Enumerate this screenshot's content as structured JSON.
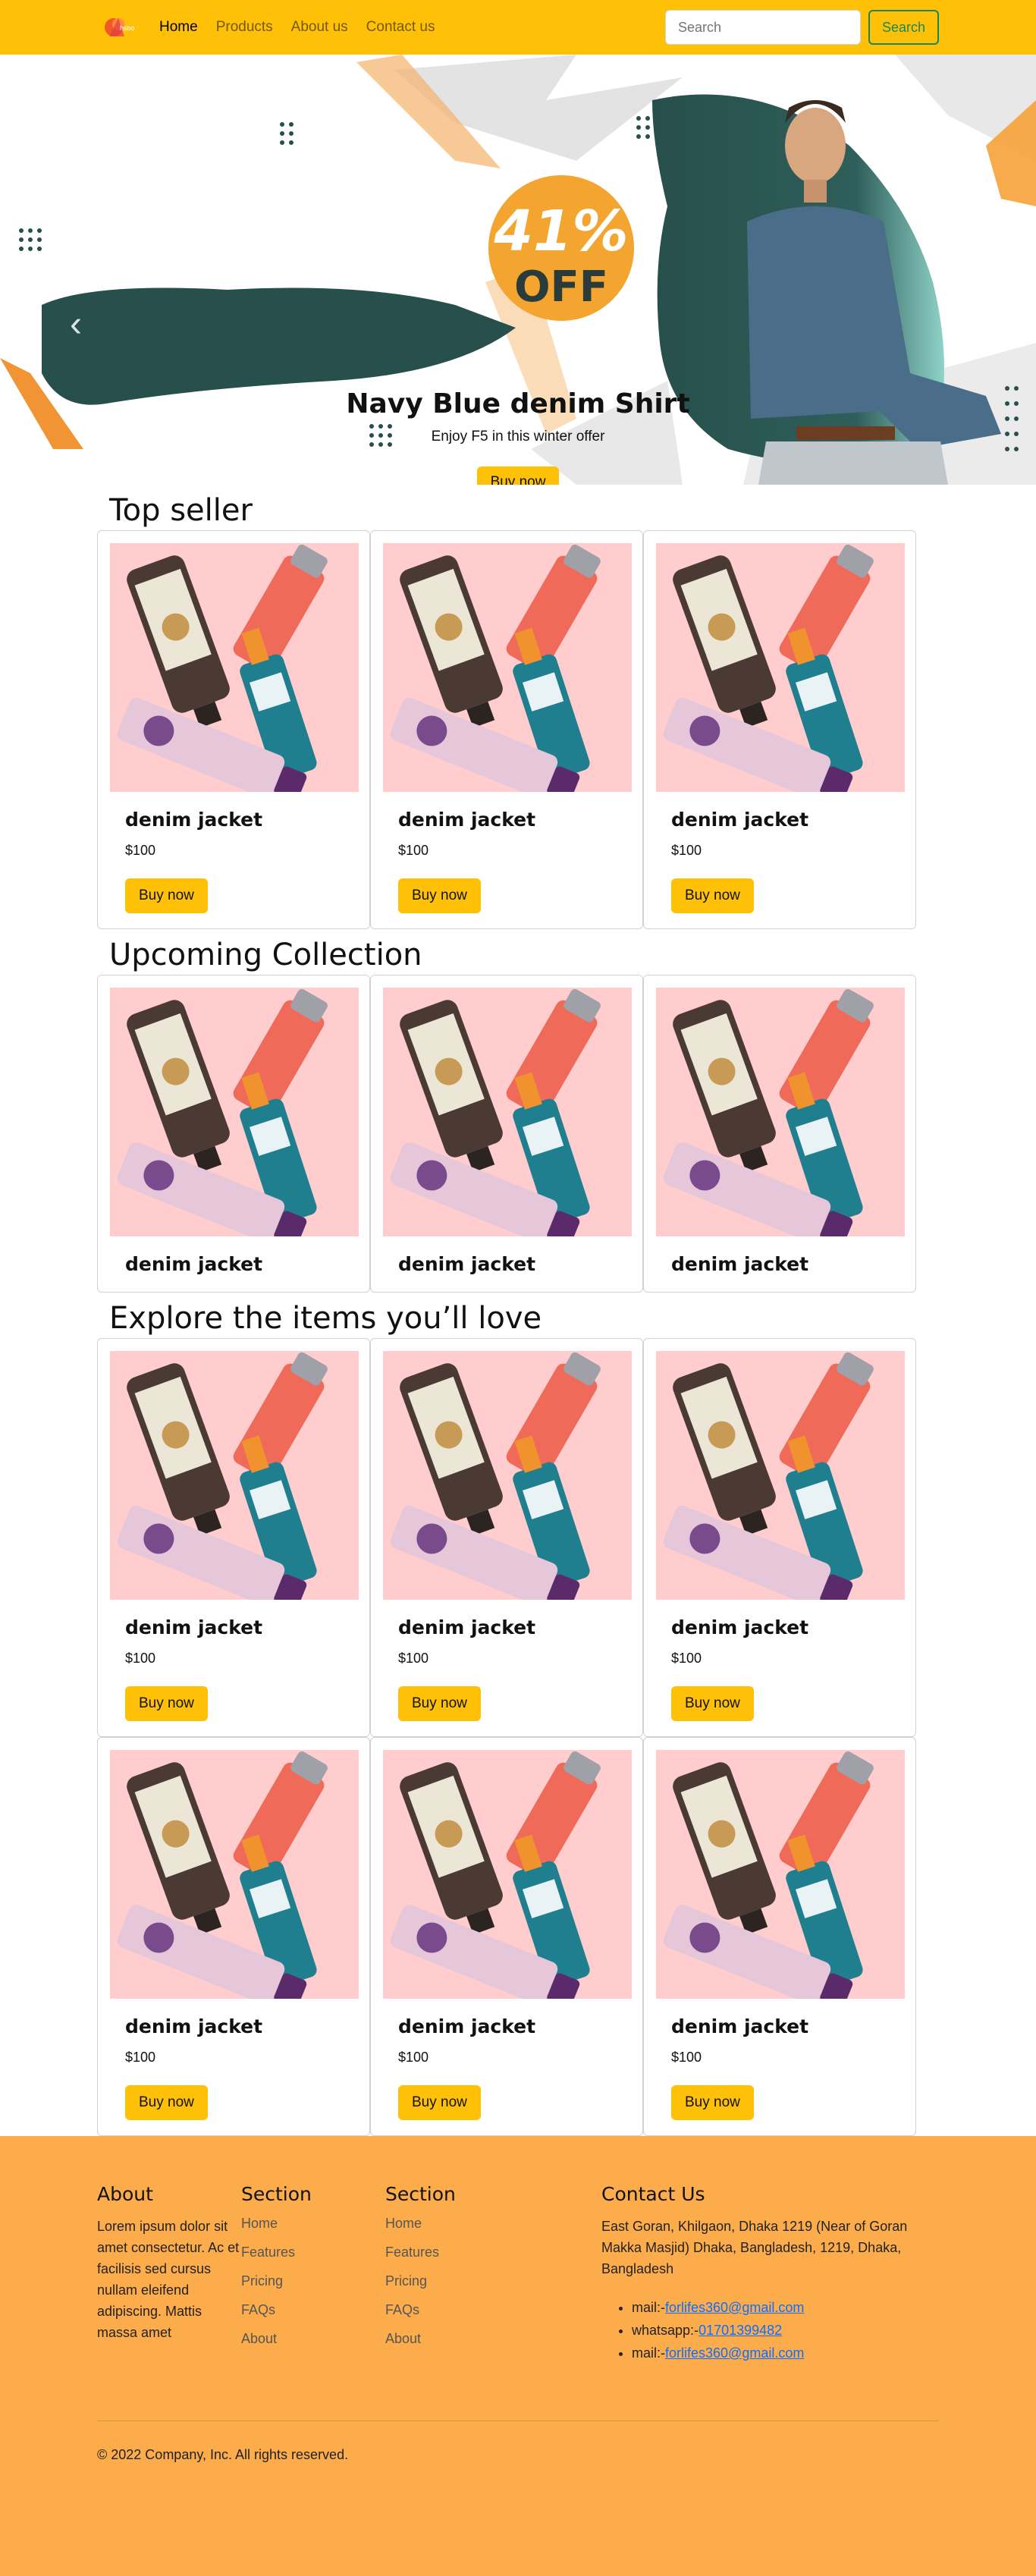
{
  "nav": {
    "links": [
      "Home",
      "Products",
      "About us",
      "Contact us"
    ],
    "search_placeholder": "Search",
    "search_button": "Search",
    "brand_color": "#ffc107"
  },
  "hero": {
    "badge_percent": "41%",
    "badge_off": "OFF",
    "title": "Navy Blue denim Shirt",
    "subtitle": "Enjoy F5 in this winter offer",
    "button": "Buy now",
    "prev_icon": "chevron-left-icon",
    "next_icon": "chevron-right-icon"
  },
  "top_seller": {
    "title": "Top seller",
    "cards": [
      {
        "name": "denim jacket",
        "price": "$100",
        "button": "Buy now"
      },
      {
        "name": "denim jacket",
        "price": "$100",
        "button": "Buy now"
      },
      {
        "name": "denim jacket",
        "price": "$100",
        "button": "Buy now"
      }
    ]
  },
  "upcoming": {
    "title": "Upcoming Collection",
    "cards": [
      {
        "name": "denim jacket"
      },
      {
        "name": "denim jacket"
      },
      {
        "name": "denim jacket"
      }
    ]
  },
  "explore": {
    "title": "Explore the items you’ll love",
    "rows": [
      [
        {
          "name": "denim jacket",
          "price": "$100",
          "button": "Buy now"
        },
        {
          "name": "denim jacket",
          "price": "$100",
          "button": "Buy now"
        },
        {
          "name": "denim jacket",
          "price": "$100",
          "button": "Buy now"
        }
      ],
      [
        {
          "name": "denim jacket",
          "price": "$100",
          "button": "Buy now"
        },
        {
          "name": "denim jacket",
          "price": "$100",
          "button": "Buy now"
        },
        {
          "name": "denim jacket",
          "price": "$100",
          "button": "Buy now"
        }
      ]
    ]
  },
  "footer": {
    "about_title": "About",
    "about_text": "Lorem ipsum dolor sit amet consectetur. Ac et facilisis sed cursus nullam eleifend adipiscing. Mattis massa amet",
    "section1": {
      "title": "Section",
      "items": [
        "Home",
        "Features",
        "Pricing",
        "FAQs",
        "About"
      ]
    },
    "section2": {
      "title": "Section",
      "items": [
        "Home",
        "Features",
        "Pricing",
        "FAQs",
        "About"
      ]
    },
    "contact_title": "Contact Us",
    "address": "East Goran, Khilgaon, Dhaka 1219 (Near of Goran Makka Masjid) Dhaka, Bangladesh, 1219, Dhaka, Bangladesh",
    "contacts": [
      {
        "label": "mail:-",
        "value": "forlifes360@gmail.com"
      },
      {
        "label": "whatsapp:-",
        "value": "01701399482"
      },
      {
        "label": "mail:-",
        "value": "forlifes360@gmail.com"
      }
    ],
    "copyright": "© 2022 Company, Inc. All rights reserved.",
    "bg_color": "#fcac4a"
  }
}
